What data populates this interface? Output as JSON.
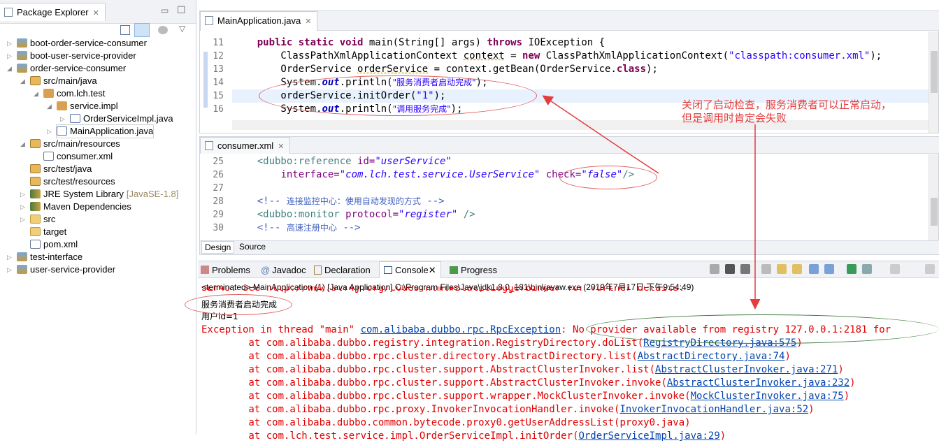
{
  "package_explorer": {
    "title": "Package Explorer",
    "items": [
      {
        "label": "boot-order-service-consumer",
        "icon": "maven-project-icon",
        "expanded": false,
        "level": 0
      },
      {
        "label": "boot-user-service-provider",
        "icon": "maven-project-icon",
        "expanded": false,
        "level": 0
      },
      {
        "label": "order-service-consumer",
        "icon": "maven-project-icon",
        "expanded": true,
        "level": 0
      },
      {
        "label": "src/main/java",
        "icon": "source-folder-icon",
        "expanded": true,
        "level": 1
      },
      {
        "label": "com.lch.test",
        "icon": "package-icon",
        "expanded": true,
        "level": 2
      },
      {
        "label": "service.impl",
        "icon": "package-icon",
        "expanded": true,
        "level": 3
      },
      {
        "label": "OrderServiceImpl.java",
        "icon": "java-file-icon",
        "expanded": false,
        "level": 4
      },
      {
        "label": "MainApplication.java",
        "icon": "java-file-icon",
        "expanded": false,
        "level": 3,
        "selected": true
      },
      {
        "label": "src/main/resources",
        "icon": "source-folder-icon",
        "expanded": true,
        "level": 1
      },
      {
        "label": "consumer.xml",
        "icon": "xml-file-icon",
        "level": 2
      },
      {
        "label": "src/test/java",
        "icon": "source-folder-icon",
        "level": 1
      },
      {
        "label": "src/test/resources",
        "icon": "source-folder-icon",
        "level": 1
      },
      {
        "label": "JRE System Library",
        "suffix": "[JavaSE-1.8]",
        "icon": "library-icon",
        "expanded": false,
        "level": 1
      },
      {
        "label": "Maven Dependencies",
        "icon": "library-icon",
        "expanded": false,
        "level": 1
      },
      {
        "label": "src",
        "icon": "folder-icon",
        "expanded": false,
        "level": 1
      },
      {
        "label": "target",
        "icon": "folder-icon",
        "level": 1
      },
      {
        "label": "pom.xml",
        "icon": "maven-file-icon",
        "level": 1
      },
      {
        "label": "test-interface",
        "icon": "maven-project-icon",
        "expanded": false,
        "level": 0
      },
      {
        "label": "user-service-provider",
        "icon": "maven-project-icon",
        "expanded": false,
        "level": 0
      }
    ]
  },
  "java_editor": {
    "tab": "MainApplication.java",
    "lines": [
      {
        "n": "11",
        "segs": [
          [
            "",
            "    "
          ],
          [
            "kw",
            "public static void "
          ],
          [
            "",
            "main(String[] args) "
          ],
          [
            "kw",
            "throws "
          ],
          [
            "",
            "IOException {"
          ]
        ]
      },
      {
        "n": "12",
        "segs": [
          [
            "",
            "        ClassPathXmlApplicationContext "
          ],
          [
            "var",
            "context"
          ],
          [
            "",
            " = "
          ],
          [
            "kw",
            "new "
          ],
          [
            "",
            "ClassPathXmlApplicationContext("
          ],
          [
            "str",
            "\"classpath:consumer.xml\""
          ],
          [
            "",
            ");"
          ]
        ]
      },
      {
        "n": "13",
        "segs": [
          [
            "",
            "        OrderService "
          ],
          [
            "var",
            "orderService"
          ],
          [
            "",
            " = context.getBean(OrderService."
          ],
          [
            "kw",
            "class"
          ],
          [
            "",
            ");"
          ]
        ]
      },
      {
        "n": "14",
        "segs": [
          [
            "",
            "        System."
          ],
          [
            "fld",
            "out"
          ],
          [
            "",
            ".println("
          ],
          [
            "str cn",
            "\"服务消费者启动完成\""
          ],
          [
            "",
            ");"
          ]
        ]
      },
      {
        "n": "15",
        "segs": [
          [
            "",
            "        orderService.initOrder("
          ],
          [
            "str",
            "\"1\""
          ],
          [
            "",
            ");"
          ]
        ]
      },
      {
        "n": "16",
        "segs": [
          [
            "",
            "        System."
          ],
          [
            "fld",
            "out"
          ],
          [
            "",
            ".println("
          ],
          [
            "str cn",
            "\"调用服务完成\""
          ],
          [
            "",
            ");"
          ]
        ]
      }
    ]
  },
  "xml_editor": {
    "tab": "consumer.xml",
    "lines": [
      {
        "n": "25",
        "segs": [
          [
            "",
            "    "
          ],
          [
            "tag",
            "<dubbo:reference "
          ],
          [
            "attr",
            "id="
          ],
          [
            "aval",
            "\"userService\""
          ]
        ]
      },
      {
        "n": "26",
        "segs": [
          [
            "",
            "        "
          ],
          [
            "attr",
            "interface="
          ],
          [
            "aval",
            "\"com.lch.test.service.UserService\""
          ],
          [
            "",
            " "
          ],
          [
            "attr",
            "check="
          ],
          [
            "aval",
            "\"false\""
          ],
          [
            "tag",
            "/>"
          ]
        ]
      },
      {
        "n": "27",
        "segs": [
          [
            "",
            ""
          ]
        ]
      },
      {
        "n": "28",
        "segs": [
          [
            "",
            "    "
          ],
          [
            "cmt",
            "<!-- "
          ],
          [
            "cmt cn",
            "连接监控中心：使用自动发现的方式"
          ],
          [
            "cmt",
            " -->"
          ]
        ]
      },
      {
        "n": "29",
        "segs": [
          [
            "",
            "    "
          ],
          [
            "tag",
            "<dubbo:monitor "
          ],
          [
            "attr",
            "protocol="
          ],
          [
            "aval",
            "\"register\""
          ],
          [
            "tag",
            " />"
          ]
        ]
      },
      {
        "n": "30",
        "segs": [
          [
            "",
            "    "
          ],
          [
            "cmt",
            "<!-- "
          ],
          [
            "cmt cn",
            "高速注册中心"
          ],
          [
            "cmt",
            " -->"
          ]
        ]
      }
    ],
    "bottom_tabs": [
      "Design",
      "Source"
    ]
  },
  "console_view": {
    "tabs": [
      "Problems",
      "Javadoc",
      "Declaration",
      "Console",
      "Progress"
    ],
    "active_tab": "Console",
    "status": "<terminated> MainApplication (1) [Java Application] C:\\Program Files\\Java\\jdk1.8.0_181\\bin\\javaw.exe (2019年7月17日 下午9:54:49)",
    "partial_line": "SLF4J: See http://www.slf4j.org/codes.html#StaticLoggerBinder for further details.",
    "line_started": "服务消费者启动完成",
    "line_userid": "用户id=1",
    "exception": {
      "prefix": "Exception in thread \"main\" ",
      "cls": "com.alibaba.dubbo.rpc.RpcException",
      "msg": ": No provider available from registry 127.0.0.1:2181 for"
    },
    "stack": [
      [
        "com.alibaba.dubbo.registry.integration.RegistryDirectory.doList(",
        "RegistryDirectory.java:575",
        ")"
      ],
      [
        "com.alibaba.dubbo.rpc.cluster.directory.AbstractDirectory.list(",
        "AbstractDirectory.java:74",
        ")"
      ],
      [
        "com.alibaba.dubbo.rpc.cluster.support.AbstractClusterInvoker.list(",
        "AbstractClusterInvoker.java:271",
        ")"
      ],
      [
        "com.alibaba.dubbo.rpc.cluster.support.AbstractClusterInvoker.invoke(",
        "AbstractClusterInvoker.java:232",
        ")"
      ],
      [
        "com.alibaba.dubbo.rpc.cluster.support.wrapper.MockClusterInvoker.invoke(",
        "MockClusterInvoker.java:75",
        ")"
      ],
      [
        "com.alibaba.dubbo.rpc.proxy.InvokerInvocationHandler.invoke(",
        "InvokerInvocationHandler.java:52",
        ")"
      ],
      [
        "com.alibaba.dubbo.common.bytecode.proxy0.getUserAddressList(proxy0.java)",
        "",
        ""
      ],
      [
        "com.lch.test.service.impl.OrderServiceImpl.initOrder(",
        "OrderServiceImpl.java:29",
        ")"
      ]
    ]
  },
  "annotation": {
    "line1": "关闭了启动检查，服务消费者可以正常启动，",
    "line2": "但是调用时肯定会失败",
    "color": "#e43b3b"
  }
}
